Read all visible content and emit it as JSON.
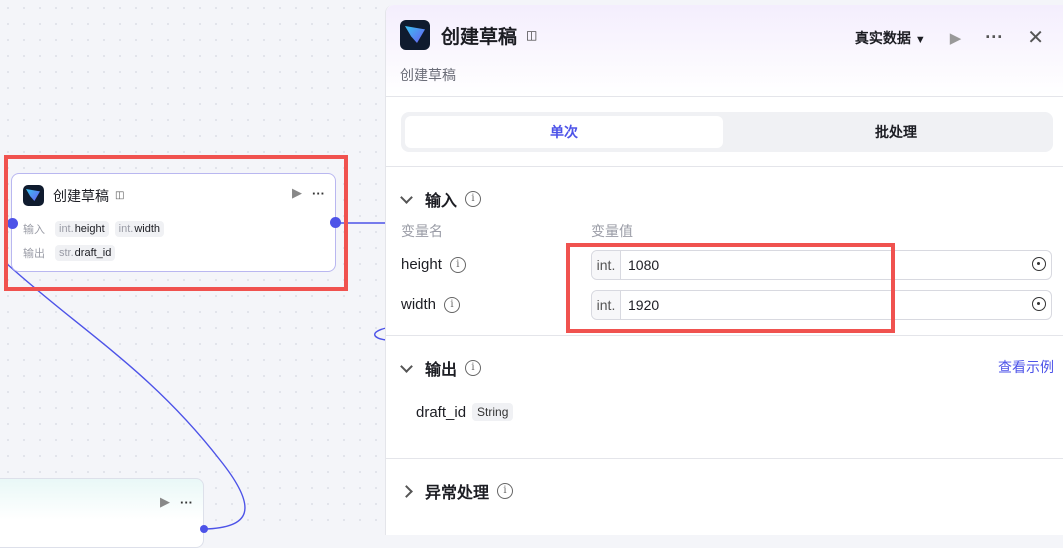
{
  "canvas": {
    "main_node": {
      "title": "创建草稿",
      "input_label": "输入",
      "output_label": "输出",
      "inputs": [
        {
          "type": "int.",
          "name": "height"
        },
        {
          "type": "int.",
          "name": "width"
        }
      ],
      "outputs": [
        {
          "type": "str.",
          "name": "draft_id"
        }
      ]
    }
  },
  "panel": {
    "title": "创建草稿",
    "description": "创建草稿",
    "data_source": "真实数据",
    "tabs": [
      "单次",
      "批处理"
    ],
    "input_section": {
      "title": "输入",
      "col_name": "变量名",
      "col_value": "变量值",
      "vars": [
        {
          "name": "height",
          "type": "int.",
          "value": "1080"
        },
        {
          "name": "width",
          "type": "int.",
          "value": "1920"
        }
      ]
    },
    "output_section": {
      "title": "输出",
      "link": "查看示例",
      "var": {
        "name": "draft_id",
        "type": "String"
      }
    },
    "error_section": {
      "title": "异常处理"
    }
  },
  "colors": {
    "accent": "#4d53e8",
    "highlight": "#f0524f"
  }
}
